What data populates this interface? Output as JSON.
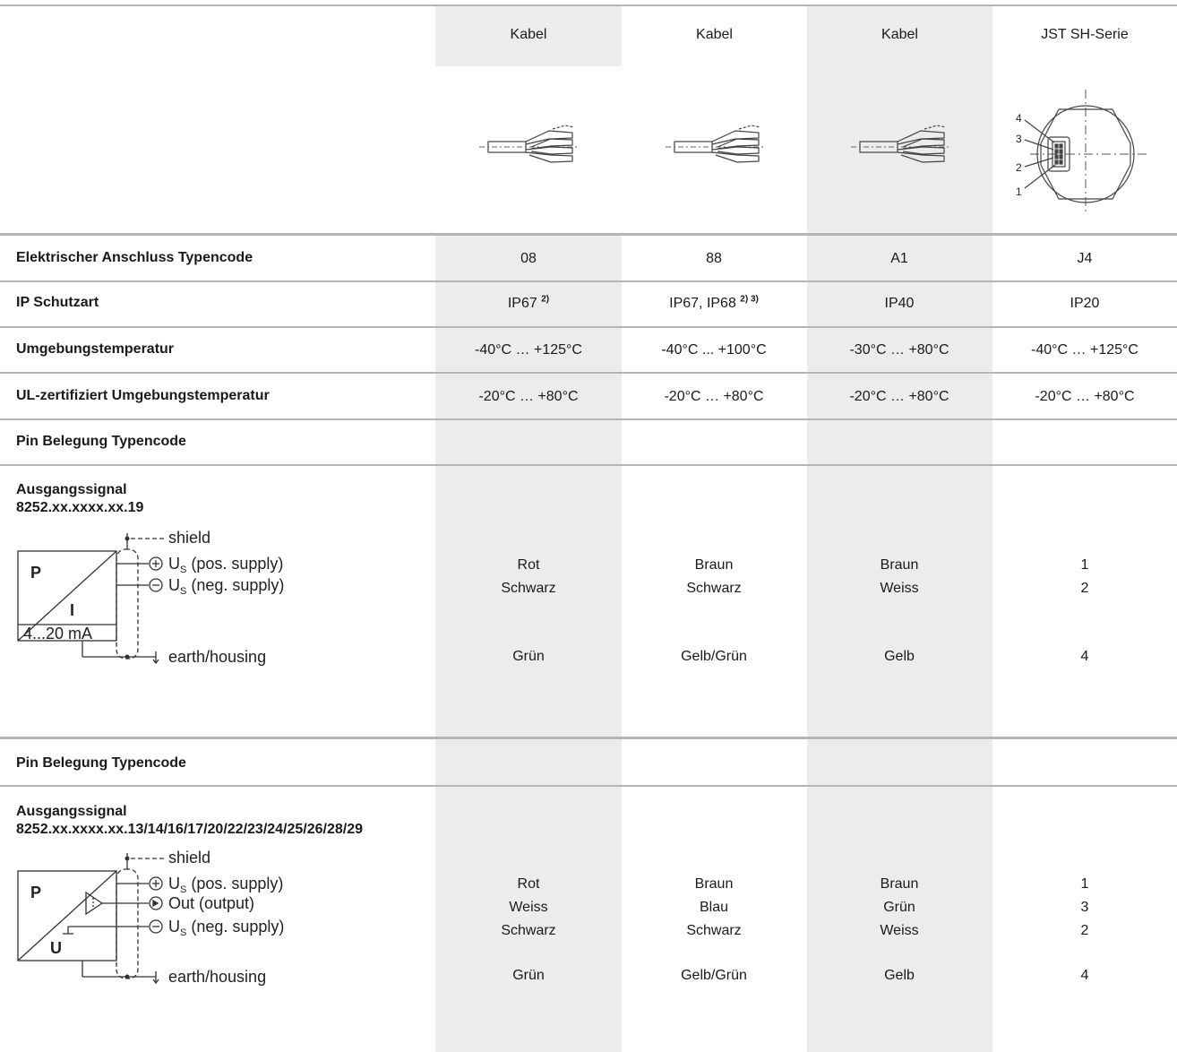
{
  "columns": [
    {
      "header": "Kabel",
      "code": "08",
      "ip": "IP67",
      "ip_notes": "2)",
      "temp": "-40°C … +125°C",
      "ul_temp": "-20°C … +80°C",
      "icon": "cable-icon"
    },
    {
      "header": "Kabel",
      "code": "88",
      "ip": "IP67, IP68",
      "ip_notes": "2) 3)",
      "temp": "-40°C ... +100°C",
      "ul_temp": "-20°C … +80°C",
      "icon": "cable-icon"
    },
    {
      "header": "Kabel",
      "code": "A1",
      "ip": "IP40",
      "ip_notes": "",
      "temp": "-30°C … +80°C",
      "ul_temp": "-20°C … +80°C",
      "icon": "cable-icon"
    },
    {
      "header": "JST SH-Serie",
      "code": "J4",
      "ip": "IP20",
      "ip_notes": "",
      "temp": "-40°C … +125°C",
      "ul_temp": "-20°C … +80°C",
      "icon": "jst-connector-icon"
    }
  ],
  "row_labels": {
    "code": "Elektrischer Anschluss Typencode",
    "ip": "IP Schutzart",
    "temp": "Umgebungstemperatur",
    "ul_temp": "UL-zertifiziert Umgebungstemperatur",
    "pin1": "Pin Belegung Typencode",
    "pin2": "Pin Belegung Typencode"
  },
  "jst_pins": [
    "4",
    "3",
    "2",
    "1"
  ],
  "section1": {
    "title": "Ausgangssignal",
    "code": "8252.xx.xxxx.xx.19",
    "schematic": {
      "box_p": "P",
      "box_i": "I",
      "box_range": "4...20 mA",
      "shield": "shield",
      "pos_supply": "U",
      "pos_supply_sub": "S",
      "pos_supply_desc": " (pos. supply)",
      "neg_supply_desc": " (neg. supply)",
      "earth": "earth/housing"
    },
    "values": [
      {
        "pos": "Rot",
        "neg": "Schwarz",
        "earth": "Grün"
      },
      {
        "pos": "Braun",
        "neg": "Schwarz",
        "earth": "Gelb/Grün"
      },
      {
        "pos": "Braun",
        "neg": "Weiss",
        "earth": "Gelb"
      },
      {
        "pos": "1",
        "neg": "2",
        "earth": "4"
      }
    ]
  },
  "section2": {
    "title": "Ausgangssignal",
    "code": "8252.xx.xxxx.xx.13/14/16/17/20/22/23/24/25/26/28/29",
    "schematic": {
      "box_p": "P",
      "box_u": "U",
      "shield": "shield",
      "pos_supply_desc": " (pos. supply)",
      "out_desc": "Out (output)",
      "neg_supply_desc": " (neg. supply)",
      "earth": "earth/housing"
    },
    "values": [
      {
        "pos": "Rot",
        "out": "Weiss",
        "neg": "Schwarz",
        "earth": "Grün"
      },
      {
        "pos": "Braun",
        "out": "Blau",
        "neg": "Schwarz",
        "earth": "Gelb/Grün"
      },
      {
        "pos": "Braun",
        "out": "Grün",
        "neg": "Weiss",
        "earth": "Gelb"
      },
      {
        "pos": "1",
        "out": "3",
        "neg": "2",
        "earth": "4"
      }
    ]
  }
}
